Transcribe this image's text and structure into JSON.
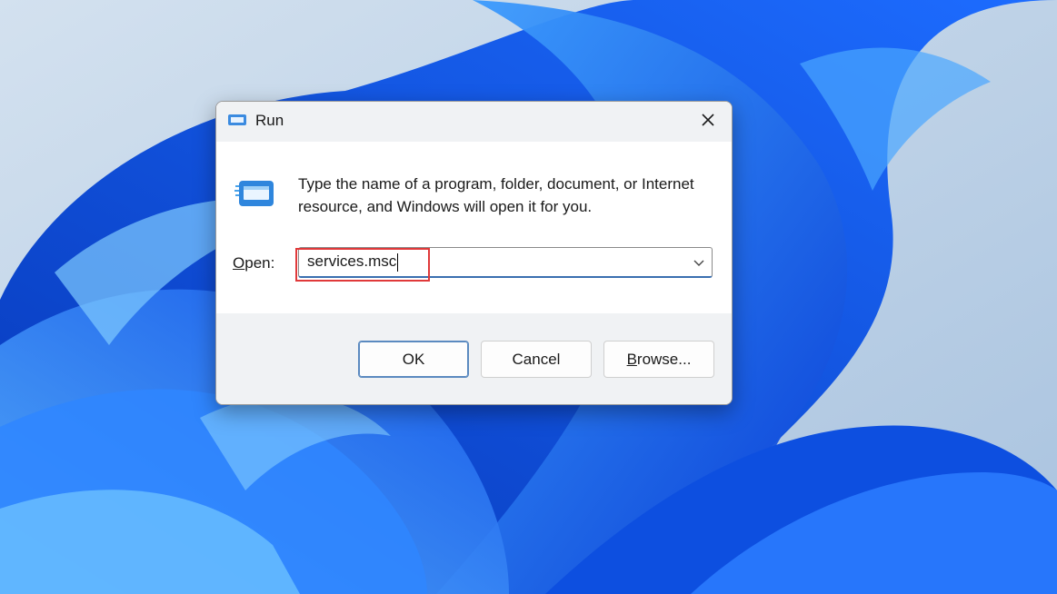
{
  "dialog": {
    "title": "Run",
    "description": "Type the name of a program, folder, document, or Internet resource, and Windows will open it for you.",
    "open_label_accel": "O",
    "open_label_rest": "pen:",
    "command_value": "services.msc",
    "buttons": {
      "ok": "OK",
      "cancel": "Cancel",
      "browse_accel": "B",
      "browse_rest": "rowse..."
    }
  },
  "icons": {
    "title": "run-icon",
    "large": "run-icon",
    "close": "close-icon",
    "dropdown": "chevron-down-icon"
  },
  "colors": {
    "highlight": "#e0393a",
    "accent": "#3a6fb0",
    "wallpaper_blue": "#0b5cf0"
  }
}
